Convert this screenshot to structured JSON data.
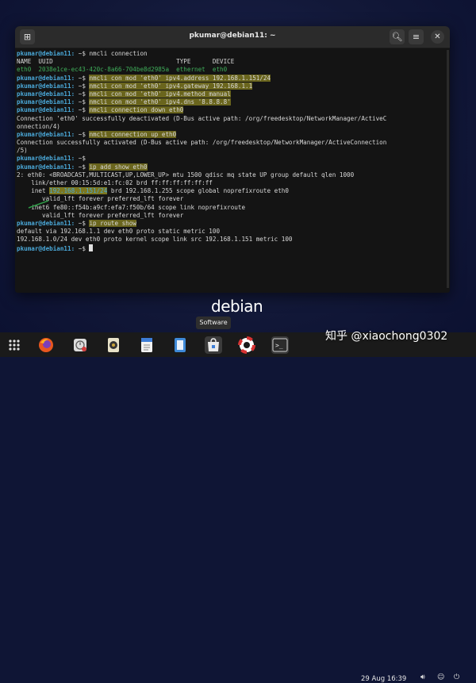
{
  "terminal": {
    "title": "pkumar@debian11: ~",
    "lines": [
      {
        "prompt": "pkumar@debian11:",
        "dir": " ~",
        "cmd": "nmcli connection",
        "hl": false
      },
      {
        "text": "NAME  UUID                                  TYPE      DEVICE"
      },
      {
        "text": "eth0  2038e1ce-ec43-420c-8a66-704be8d2985a  ethernet  eth0",
        "color": "green"
      },
      {
        "prompt": "pkumar@debian11:",
        "dir": " ~",
        "cmd": "nmcli con mod 'eth0' ipv4.address 192.168.1.151/24",
        "hl": true
      },
      {
        "prompt": "pkumar@debian11:",
        "dir": " ~",
        "cmd": "nmcli con mod 'eth0' ipv4.gateway 192.168.1.1",
        "hl": true
      },
      {
        "prompt": "pkumar@debian11:",
        "dir": " ~",
        "cmd": "nmcli con mod 'eth0' ipv4.method manual",
        "hl": true
      },
      {
        "prompt": "pkumar@debian11:",
        "dir": " ~",
        "cmd": "nmcli con mod 'eth0' ipv4.dns '8.8.8.8'",
        "hl": true
      },
      {
        "prompt": "pkumar@debian11:",
        "dir": " ~",
        "cmd": "nmcli connection down eth0",
        "hl": true
      },
      {
        "text": "Connection 'eth0' successfully deactivated (D-Bus active path: /org/freedesktop/NetworkManager/ActiveC"
      },
      {
        "text": "onnection/4)"
      },
      {
        "prompt": "pkumar@debian11:",
        "dir": " ~",
        "cmd": "nmcli connection up eth0",
        "hl": true
      },
      {
        "text": "Connection successfully activated (D-Bus active path: /org/freedesktop/NetworkManager/ActiveConnection"
      },
      {
        "text": "/5)"
      },
      {
        "prompt": "pkumar@debian11:",
        "dir": " ~",
        "cmd": "",
        "hl": false
      },
      {
        "prompt": "pkumar@debian11:",
        "dir": " ~",
        "cmd": "ip add show eth0",
        "hl": true
      },
      {
        "text": "2: eth0: <BROADCAST,MULTICAST,UP,LOWER_UP> mtu 1500 qdisc mq state UP group default qlen 1000"
      },
      {
        "text": "    link/ether 00:15:5d:e1:fc:02 brd ff:ff:ff:ff:ff:ff"
      },
      {
        "pre": "    inet ",
        "ip": "192.168.1.151/24",
        "post": " brd 192.168.1.255 scope global noprefixroute eth0"
      },
      {
        "text": "       valid_lft forever preferred_lft forever"
      },
      {
        "text": "    inet6 fe80::f54b:a9cf:efa7:f50b/64 scope link noprefixroute"
      },
      {
        "text": "       valid_lft forever preferred_lft forever"
      },
      {
        "prompt": "pkumar@debian11:",
        "dir": " ~",
        "cmd": "ip route show",
        "hl": true
      },
      {
        "text": "default via 192.168.1.1 dev eth0 proto static metric 100"
      },
      {
        "text": "192.168.1.0/24 dev eth0 proto kernel scope link src 192.168.1.151 metric 100"
      },
      {
        "prompt": "pkumar@debian11:",
        "dir": " ~",
        "cmd": "",
        "hl": false,
        "cursor": true
      }
    ]
  },
  "desktop": {
    "logo": "debian",
    "tooltip": "Software"
  },
  "taskbar": {
    "apps": [
      "app-grid-icon",
      "firefox-icon",
      "clock-icon",
      "audio-icon",
      "text-editor-icon",
      "notes-icon",
      "software-icon",
      "help-icon",
      "terminal-icon"
    ],
    "clock": "29 Aug 16:39"
  },
  "watermark": "知乎 @xiaochong0302",
  "colors": {
    "prompt": "#4aa8d8",
    "highlight": "#d2c828",
    "output_green": "#3fae5a",
    "terminal_bg": "#141414"
  }
}
